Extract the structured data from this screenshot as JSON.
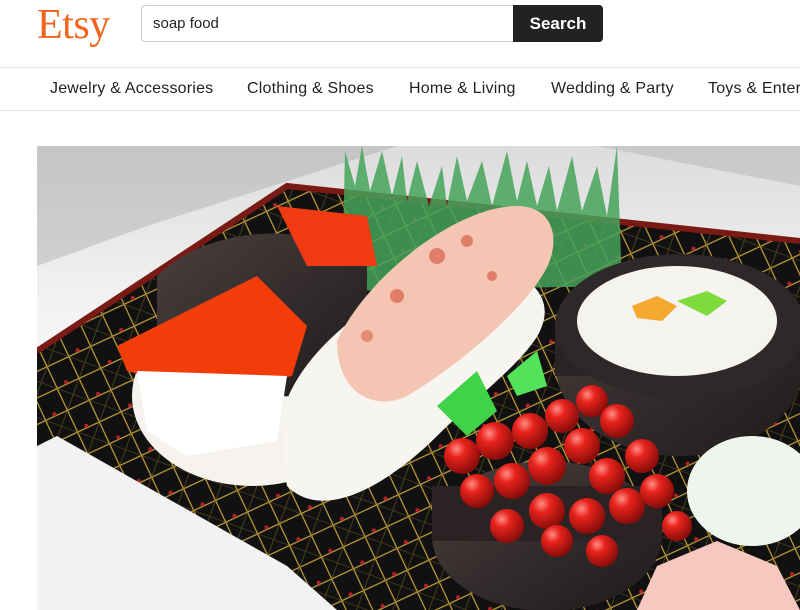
{
  "header": {
    "logo_text": "Etsy",
    "search": {
      "value": "soap food",
      "placeholder": ""
    },
    "search_button_label": "Search"
  },
  "nav": {
    "items": [
      {
        "label": "Jewelry & Accessories"
      },
      {
        "label": "Clothing & Shoes"
      },
      {
        "label": "Home & Living"
      },
      {
        "label": "Wedding & Party"
      },
      {
        "label": "Toys & Entertainment"
      }
    ]
  },
  "hero": {
    "image_subject": "soap-sushi-bento"
  },
  "colors": {
    "brand": "#f1641e",
    "search_button": "#222222",
    "divider": "#e1e1e1"
  }
}
